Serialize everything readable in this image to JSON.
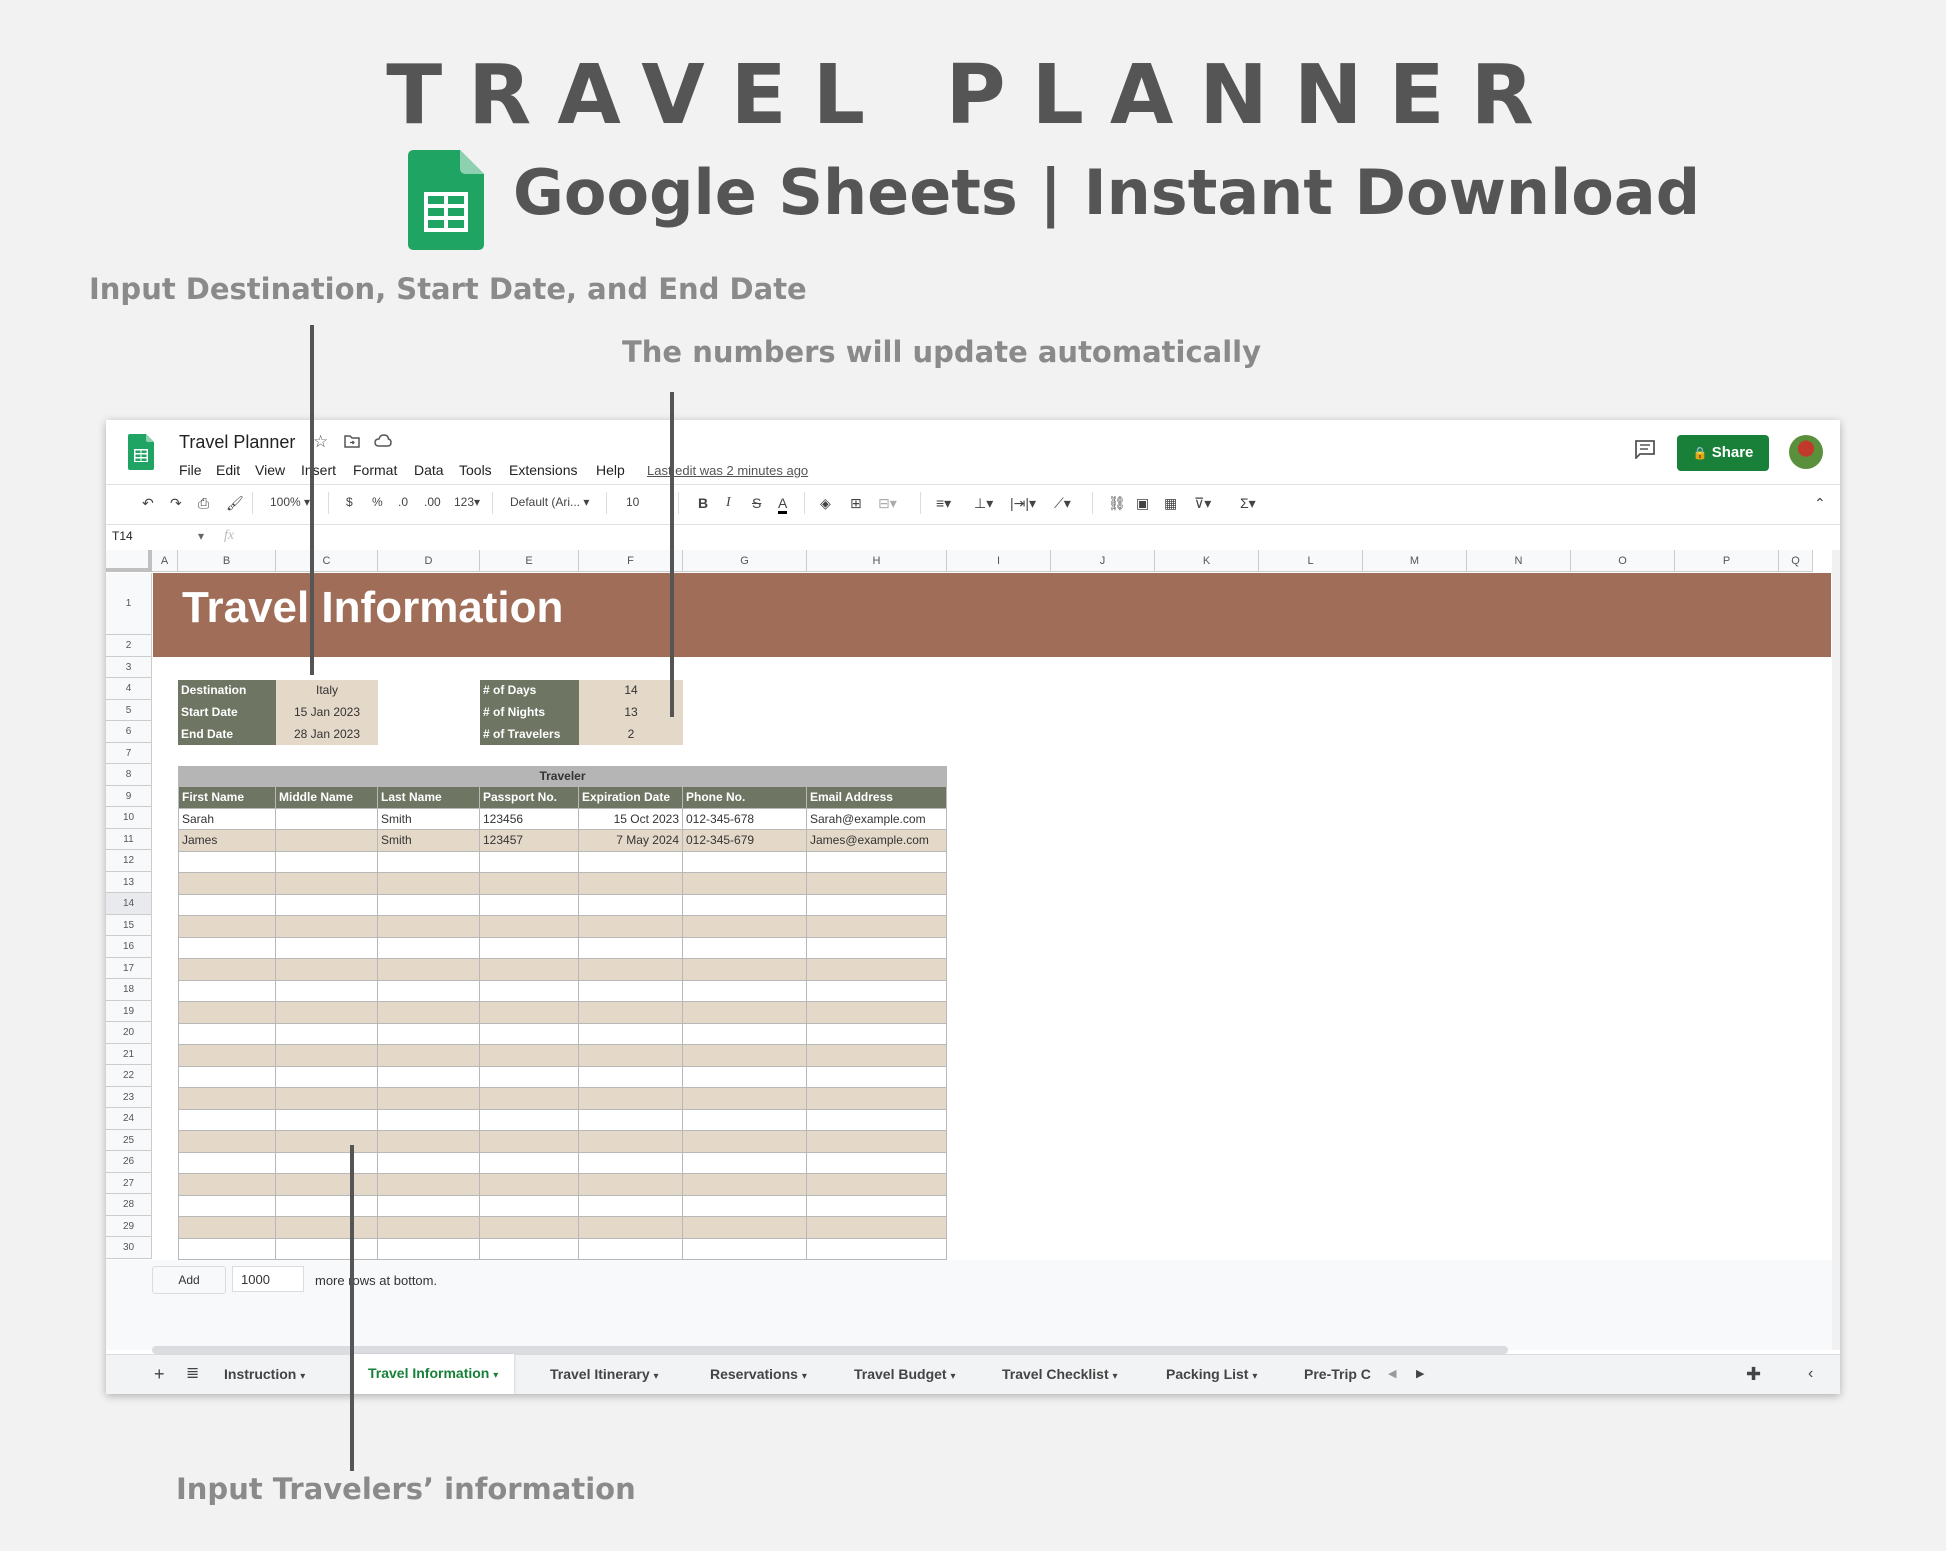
{
  "promo": {
    "title": "TRAVEL PLANNER",
    "subtitle": "Google Sheets | Instant Download",
    "annotation_input_dates": "Input Destination, Start Date, and End Date",
    "annotation_auto_numbers": "The numbers will update automatically",
    "annotation_travelers": "Input Travelers’ information"
  },
  "app": {
    "doc_title": "Travel Planner",
    "menu": [
      "File",
      "Edit",
      "View",
      "Insert",
      "Format",
      "Data",
      "Tools",
      "Extensions",
      "Help"
    ],
    "last_edit": "Last edit was 2 minutes ago",
    "share_label": "Share",
    "colors": {
      "brand_green": "#188038",
      "header_brown": "#a06d58",
      "label_green": "#6e7563",
      "fill_tan": "#e4d9c9",
      "traveler_gray": "#b5b5b5"
    }
  },
  "toolbar": {
    "zoom": "100%",
    "currency": "$",
    "percent": "%",
    "dec_less": ".0",
    "dec_more": ".00",
    "number_format": "123",
    "font": "Default (Ari...",
    "font_size": "10",
    "bold": "B",
    "italic": "I",
    "strike": "S",
    "text_color": "A"
  },
  "formula_bar": {
    "cell_ref": "T14",
    "fx": "fx"
  },
  "columns": [
    "A",
    "B",
    "C",
    "D",
    "E",
    "F",
    "G",
    "H",
    "I",
    "J",
    "K",
    "L",
    "M",
    "N",
    "O",
    "P",
    "Q"
  ],
  "rows": [
    "1",
    "2",
    "3",
    "4",
    "5",
    "6",
    "7",
    "8",
    "9",
    "10",
    "11",
    "12",
    "13",
    "14",
    "15",
    "16",
    "17",
    "18",
    "19",
    "20",
    "21",
    "22",
    "23",
    "24",
    "25",
    "26",
    "27",
    "28",
    "29",
    "30"
  ],
  "sheet": {
    "banner_title": "Travel Information",
    "trip": {
      "destination_label": "Destination",
      "destination": "Italy",
      "start_label": "Start Date",
      "start": "15 Jan 2023",
      "end_label": "End Date",
      "end": "28 Jan 2023"
    },
    "summary": {
      "days_label": "# of Days",
      "days": "14",
      "nights_label": "# of Nights",
      "nights": "13",
      "travelers_label": "# of Travelers",
      "travelers": "2"
    },
    "traveler_table": {
      "title": "Traveler",
      "headers": [
        "First Name",
        "Middle Name",
        "Last Name",
        "Passport No.",
        "Expiration Date",
        "Phone No.",
        "Email Address"
      ],
      "rows": [
        [
          "Sarah",
          "",
          "Smith",
          "123456",
          "15 Oct 2023",
          "012-345-678",
          "Sarah@example.com"
        ],
        [
          "James",
          "",
          "Smith",
          "123457",
          "7 May 2024",
          "012-345-679",
          "James@example.com"
        ]
      ]
    }
  },
  "add_rows": {
    "button": "Add",
    "count": "1000",
    "suffix": "more rows at bottom."
  },
  "tabs": {
    "items": [
      "Instruction",
      "Travel Information",
      "Travel Itinerary",
      "Reservations",
      "Travel Budget",
      "Travel Checklist",
      "Packing List",
      "Pre-Trip C"
    ],
    "active": "Travel Information"
  }
}
